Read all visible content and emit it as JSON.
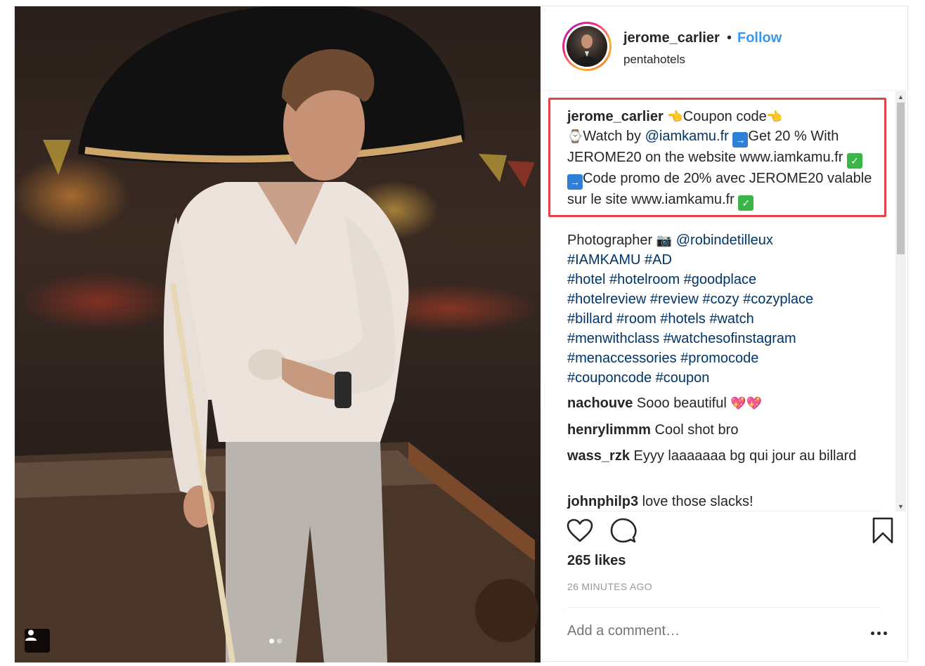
{
  "post": {
    "username": "jerome_carlier",
    "separator": "•",
    "follow_label": "Follow",
    "location": "pentahotels"
  },
  "caption": {
    "username": "jerome_carlier",
    "line1_text": "Coupon code",
    "watch_by": "Watch by",
    "mention": "@iamkamu.fr",
    "line2_text": "Get 20 % With JEROME20 on the website www.iamkamu.fr",
    "line3_text": "Code promo de 20% avec JEROME20 valable sur le site www.iamkamu.fr"
  },
  "photographer": {
    "label": "Photographer",
    "mention": "@robindetilleux",
    "hashtags": [
      "#IAMKAMU #AD",
      "#hotel #hotelroom #goodplace",
      "#hotelreview #review #cozy #cozyplace",
      "#billard #room #hotels #watch",
      "#menwithclass #watchesofinstagram",
      "#menaccessories #promocode",
      "#couponcode #coupon"
    ]
  },
  "comments": [
    {
      "user": "nachouve",
      "text": "Sooo beautiful"
    },
    {
      "user": "henrylimmm",
      "text": "Cool shot bro"
    },
    {
      "user": "wass_rzk",
      "text": "Eyyy laaaaaaa bg qui jour au billard"
    },
    {
      "user": "johnphilp3",
      "text": "love those slacks!"
    }
  ],
  "footer": {
    "likes": "265 likes",
    "time": "26 MINUTES AGO",
    "comment_placeholder": "Add a comment…"
  },
  "icons": {
    "like": "heart-icon",
    "comment": "comment-icon",
    "save": "bookmark-icon",
    "more": "more-options-icon",
    "tag": "user-tag-icon"
  },
  "colors": {
    "follow_blue": "#3897f0",
    "mention_blue": "#003569",
    "highlight_red": "#e0454b",
    "muted_gray": "#999999"
  }
}
